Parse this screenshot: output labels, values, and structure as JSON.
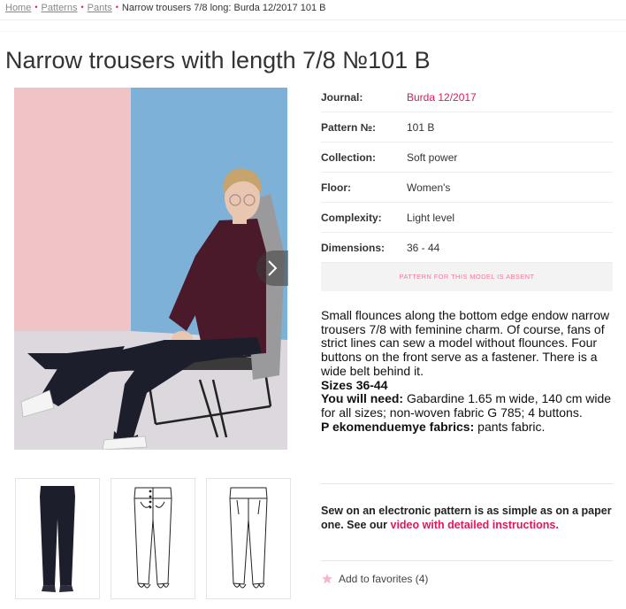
{
  "breadcrumb": {
    "home": "Home",
    "patterns": "Patterns",
    "pants": "Pants",
    "current": "Narrow trousers 7/8 long: Burda 12/2017 101 B",
    "separator": "•"
  },
  "page_title": "Narrow trousers with length 7/8 №101 B",
  "info": {
    "journal_label": "Journal:",
    "journal_value": "Burda 12/2017",
    "pattern_label": "Pattern №:",
    "pattern_value": "101 B",
    "collection_label": "Collection:",
    "collection_value": "Soft power",
    "floor_label": "Floor:",
    "floor_value": "Women's",
    "complexity_label": "Complexity:",
    "complexity_value": "Light level",
    "dimensions_label": "Dimensions:",
    "dimensions_value": "36 - 44"
  },
  "absent_notice": "PATTERN FOR THIS MODEL IS ABSENT",
  "description": {
    "text": "Small flounces along the bottom edge endow narrow trousers 7/8 with feminine charm. Of course, fans of strict lines can sew a model without flounces. Four buttons on the front serve as a fastener. There is a wide belt behind it.",
    "sizes": "Sizes 36-44",
    "need_label": "You will need:",
    "need_value": " Gabardine 1.65 m wide, 140 cm wide for all sizes; non-woven fabric G 785; 4 buttons.",
    "fabrics_label": "P ekomenduemye fabrics:",
    "fabrics_value": " pants fabric."
  },
  "promo": {
    "text": "Sew on an electronic pattern is as simple as on a paper one. See our ",
    "link": "video with detailed instructions."
  },
  "favorites": {
    "label": "Add to favorites",
    "count": "(4)"
  },
  "colors": {
    "accent": "#e2165e",
    "absent_text": "#f07b9a",
    "photo_bg_pink": "#f0c4c6",
    "photo_bg_blue": "#7eb1d7",
    "sweater": "#4a1a2a",
    "trousers": "#1c1e2c"
  },
  "icons": {
    "next": "chevron-right-icon",
    "favorite": "star-icon"
  }
}
